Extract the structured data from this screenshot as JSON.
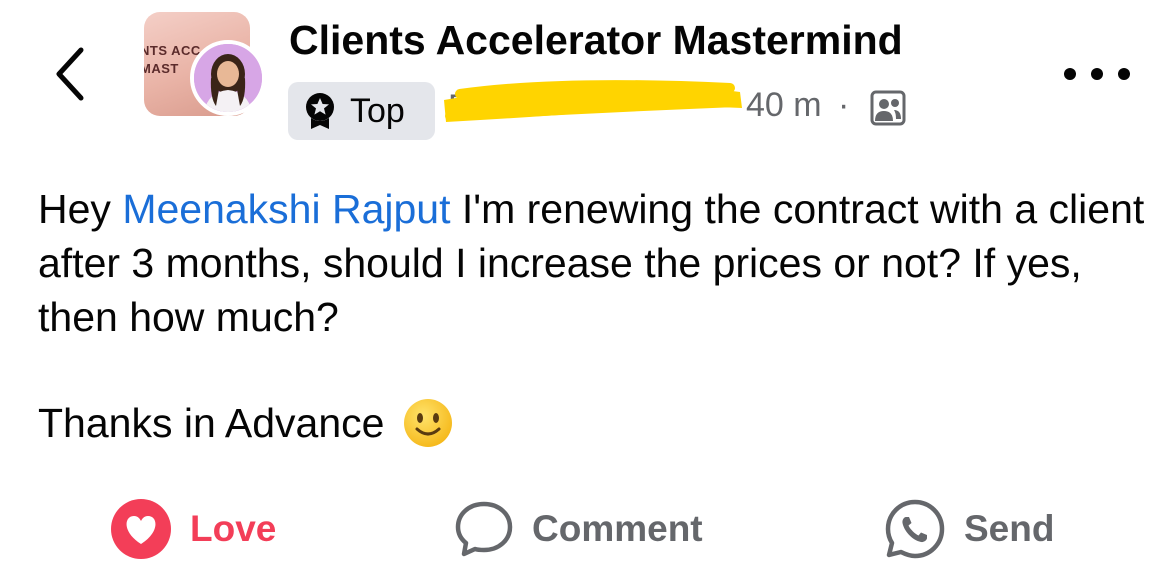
{
  "header": {
    "group_name": "Clients Accelerator Mastermind",
    "thumbnail_text": "NTS ACC\nMAST",
    "badge_label": "Top",
    "author_name": "P",
    "time": "40 m",
    "separator": "·",
    "privacy_icon": "members-only-icon",
    "more_icon": "more-dots-icon",
    "back_icon": "chevron-left-icon"
  },
  "post": {
    "greeting": "Hey ",
    "mention": "Meenakshi Rajput",
    "text": " I'm renewing the contract with a client after 3 months, should I increase the prices or not? If yes, then how much?",
    "closing": "Thanks in Advance",
    "emoji": "slightly-smiling-face-emoji"
  },
  "actions": {
    "love_label": "Love",
    "comment_label": "Comment",
    "send_label": "Send"
  },
  "colors": {
    "love": "#f33e58",
    "mention": "#1a6ed8",
    "secondary_text": "#65676b",
    "redaction": "#ffd400"
  }
}
